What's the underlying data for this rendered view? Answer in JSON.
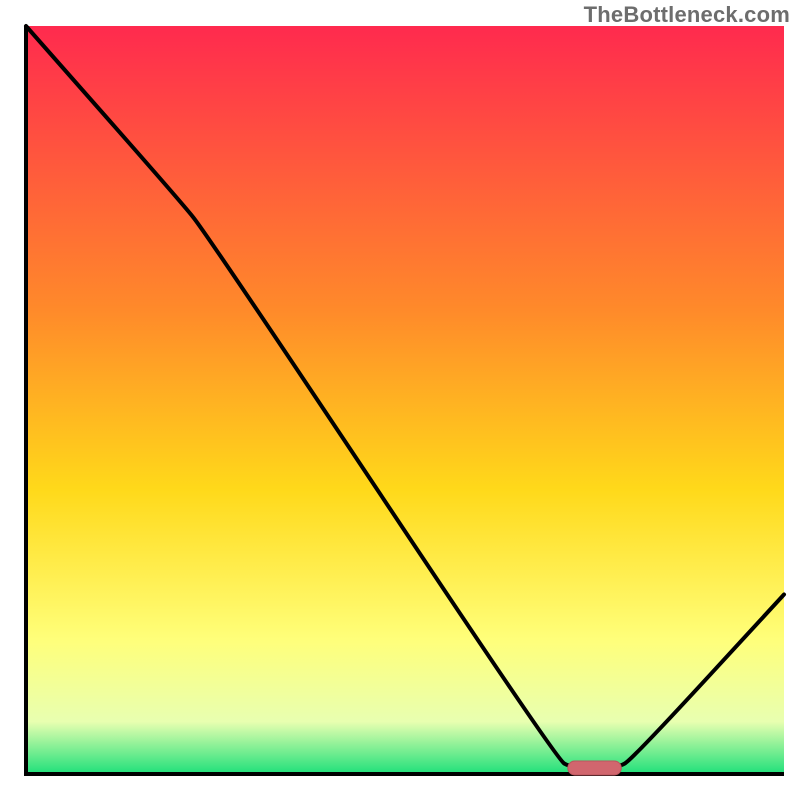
{
  "watermark": "TheBottleneck.com",
  "colors": {
    "gradient_top": "#ff2a4e",
    "gradient_mid_upper": "#ff8a2a",
    "gradient_mid": "#ffd91a",
    "gradient_low": "#ffff7a",
    "gradient_lower": "#e8ffb0",
    "gradient_bottom": "#1fe07a",
    "axis": "#000000",
    "curve": "#000000",
    "marker_fill": "#d1666e",
    "marker_stroke": "#b9555d"
  },
  "chart_data": {
    "type": "line",
    "title": "",
    "xlabel": "",
    "ylabel": "",
    "xlim": [
      0,
      100
    ],
    "ylim": [
      0,
      100
    ],
    "grid": false,
    "legend": false,
    "annotations": [],
    "curve_points": [
      {
        "x": 0,
        "y": 100
      },
      {
        "x": 20,
        "y": 77
      },
      {
        "x": 24,
        "y": 72
      },
      {
        "x": 70,
        "y": 2
      },
      {
        "x": 72,
        "y": 0.8
      },
      {
        "x": 78,
        "y": 0.8
      },
      {
        "x": 80,
        "y": 2
      },
      {
        "x": 100,
        "y": 24
      }
    ],
    "marker": {
      "x_start": 72,
      "x_end": 78,
      "y": 0.8
    }
  }
}
